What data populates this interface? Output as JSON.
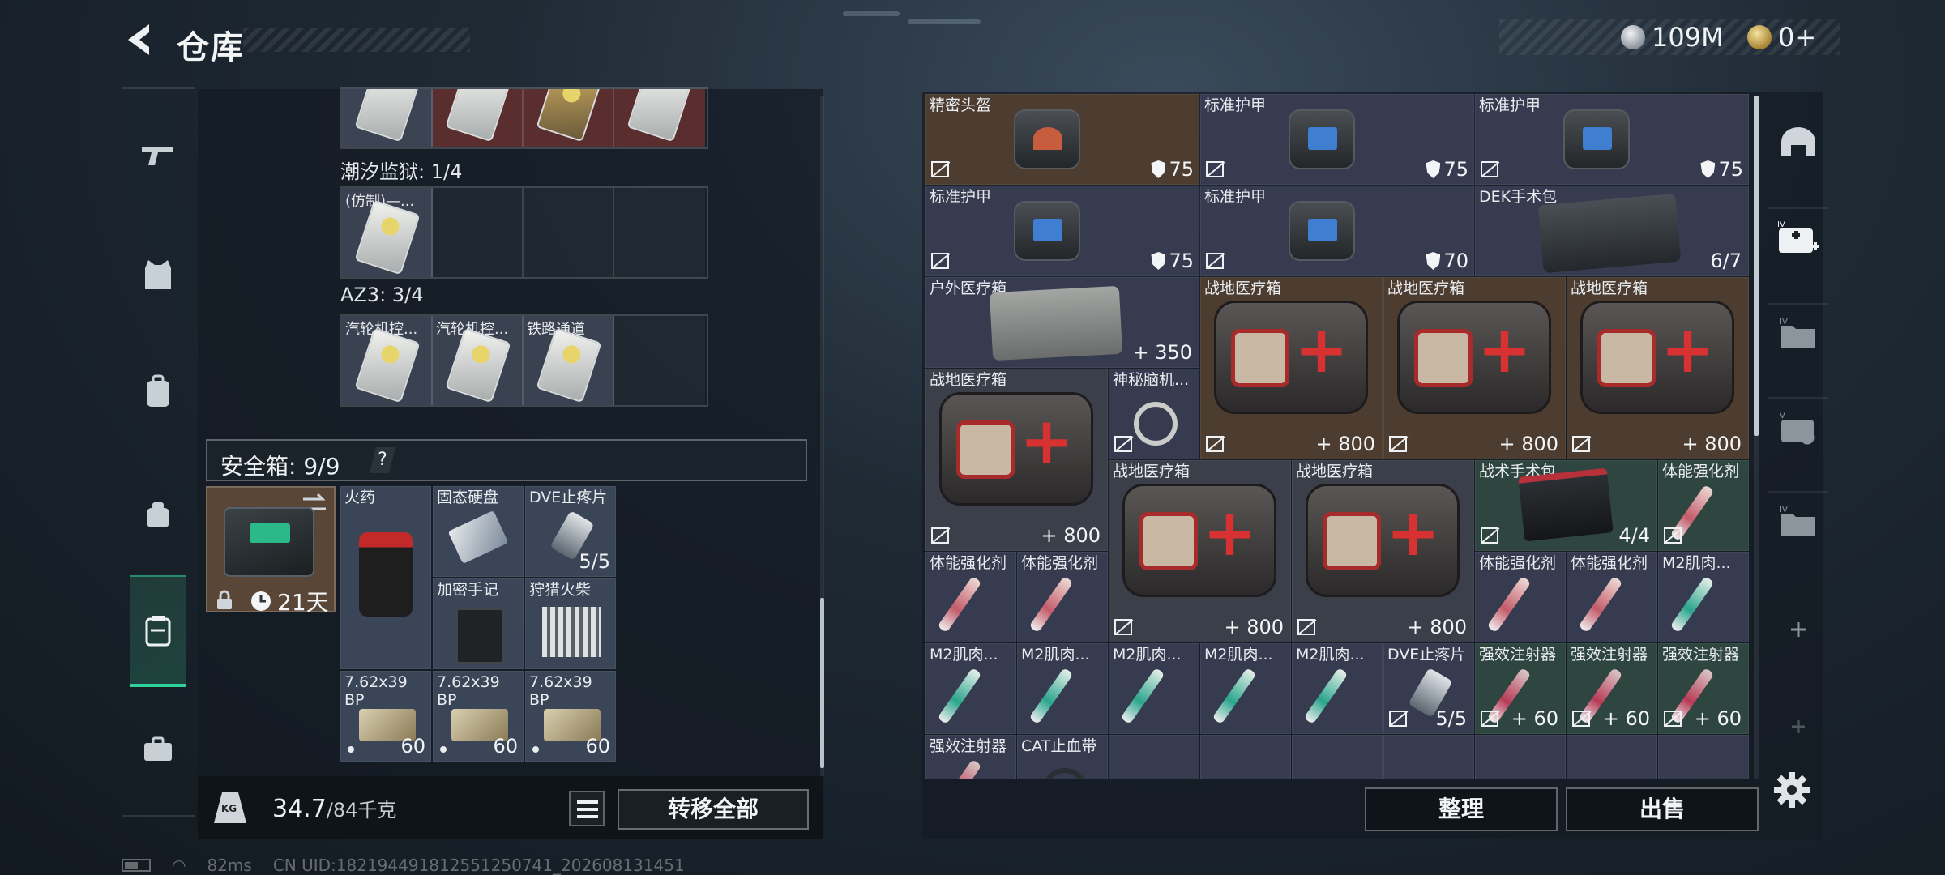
{
  "header": {
    "title": "仓库"
  },
  "currency": {
    "silver_amount": "109M",
    "gold_amount": "0+"
  },
  "left": {
    "top_slots_partial": 4,
    "sections": [
      {
        "label": "潮汐监狱: 1/4",
        "slots": [
          {
            "label": "(仿制)—..."
          },
          {},
          {},
          {}
        ]
      },
      {
        "label": "AZ3: 3/4",
        "slots": [
          {
            "label": "汽轮机控..."
          },
          {
            "label": "汽轮机控..."
          },
          {
            "label": "铁路通道"
          },
          {}
        ]
      }
    ]
  },
  "safe": {
    "title": "安全箱: 9/9",
    "help": "?",
    "timer": "21天",
    "items": [
      {
        "label": "火药",
        "qty": ""
      },
      {
        "label": "固态硬盘",
        "qty": ""
      },
      {
        "label": "DVE止疼片",
        "qty": "5/5"
      },
      {
        "label": "",
        "qty": ""
      },
      {
        "label": "加密手记",
        "qty": ""
      },
      {
        "label": "狩猎火柴",
        "qty": ""
      },
      {
        "label": "7.62x39 BP",
        "qty": "60"
      },
      {
        "label": "7.62x39 BP",
        "qty": "60"
      },
      {
        "label": "7.62x39 BP",
        "qty": "60"
      }
    ]
  },
  "weight": {
    "current": "34.7",
    "max": "/84千克"
  },
  "buttons": {
    "transfer_all": "转移全部",
    "sort": "整理",
    "sell": "出售"
  },
  "stash": {
    "items": [
      {
        "label": "精密头盔",
        "value": "75",
        "kind": "armor"
      },
      {
        "label": "标准护甲",
        "value": "75",
        "kind": "armor"
      },
      {
        "label": "标准护甲",
        "value": "75",
        "kind": "armor"
      },
      {
        "label": "标准护甲",
        "value": "75",
        "kind": "armor"
      },
      {
        "label": "标准护甲",
        "value": "70",
        "kind": "armor"
      },
      {
        "label": "DEK手术包",
        "value": "6/7",
        "kind": "count"
      },
      {
        "label": "户外医疗箱",
        "value": "+ 350",
        "kind": "heal"
      },
      {
        "label": "战地医疗箱",
        "value": "+ 800",
        "kind": "heal"
      },
      {
        "label": "战地医疗箱",
        "value": "+ 800",
        "kind": "heal"
      },
      {
        "label": "战地医疗箱",
        "value": "+ 800",
        "kind": "heal"
      },
      {
        "label": "战地医疗箱",
        "value": "+ 800",
        "kind": "heal"
      },
      {
        "label": "神秘脑机...",
        "value": "",
        "kind": "misc"
      },
      {
        "label": "战地医疗箱",
        "value": "+ 800",
        "kind": "heal"
      },
      {
        "label": "战地医疗箱",
        "value": "+ 800",
        "kind": "heal"
      },
      {
        "label": "战术手术包",
        "value": "4/4",
        "kind": "count"
      },
      {
        "label": "体能强化剂",
        "value": "",
        "kind": "syringe"
      },
      {
        "label": "体能强化剂",
        "value": "",
        "kind": "syringe"
      },
      {
        "label": "体能强化剂",
        "value": "",
        "kind": "syringe"
      },
      {
        "label": "体能强化剂",
        "value": "",
        "kind": "syringe"
      },
      {
        "label": "体能强化剂",
        "value": "",
        "kind": "syringe"
      },
      {
        "label": "M2肌肉...",
        "value": "",
        "kind": "syringe"
      },
      {
        "label": "M2肌肉...",
        "value": "",
        "kind": "syringe"
      },
      {
        "label": "M2肌肉...",
        "value": "",
        "kind": "syringe"
      },
      {
        "label": "M2肌肉...",
        "value": "",
        "kind": "syringe"
      },
      {
        "label": "M2肌肉...",
        "value": "",
        "kind": "syringe"
      },
      {
        "label": "M2肌肉...",
        "value": "",
        "kind": "syringe"
      },
      {
        "label": "DVE止疼片",
        "value": "5/5",
        "kind": "count"
      },
      {
        "label": "强效注射器",
        "value": "+ 60",
        "kind": "heal"
      },
      {
        "label": "强效注射器",
        "value": "+ 60",
        "kind": "heal"
      },
      {
        "label": "强效注射器",
        "value": "+ 60",
        "kind": "heal"
      },
      {
        "label": "强效注射器",
        "value": "",
        "kind": "syringe"
      },
      {
        "label": "CAT止血带",
        "value": "",
        "kind": "misc"
      }
    ]
  },
  "footer": {
    "ping": "82ms",
    "uid": "CN UID:1821944918125512507​41_202608131451"
  },
  "icons": {
    "back": "back-arrow-icon",
    "silver": "silver-coin-icon",
    "gold": "gold-coin-icon",
    "nav": [
      "gun-icon",
      "vest-icon",
      "backpack-icon",
      "pouch-icon",
      "safe-box-icon",
      "briefcase-icon"
    ],
    "rnav": [
      "helmet-icon",
      "medical-kit-icon",
      "folder-iv-icon",
      "folder-v-icon",
      "folder-iv-2-icon",
      "plus-icon",
      "plus-icon-2"
    ]
  }
}
